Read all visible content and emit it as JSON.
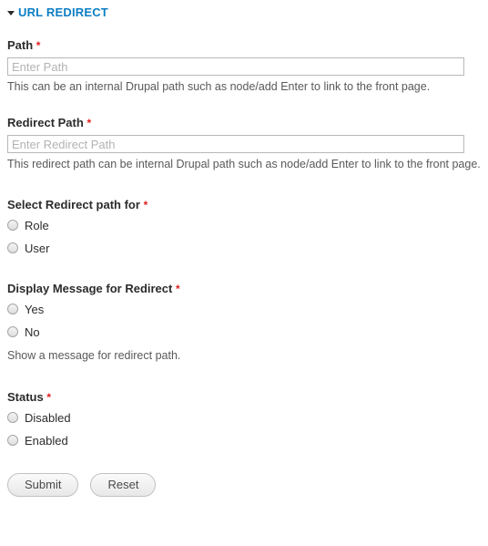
{
  "fieldset": {
    "title": "URL REDIRECT",
    "toggle_icon": "caret-down-icon",
    "accent_color": "#0c7ec4"
  },
  "required_marker": "*",
  "fields": {
    "path": {
      "label": "Path",
      "required": true,
      "placeholder": "Enter Path",
      "value": "",
      "description": "This can be an internal Drupal path such as node/add Enter to link to the front page."
    },
    "redirect_path": {
      "label": "Redirect Path",
      "required": true,
      "placeholder": "Enter Redirect Path",
      "value": "",
      "description": "This redirect path can be internal Drupal path such as node/add Enter to link to the front page."
    },
    "select_redirect_path_for": {
      "label": "Select Redirect path for",
      "required": true,
      "options": [
        {
          "label": "Role",
          "checked": false
        },
        {
          "label": "User",
          "checked": false
        }
      ]
    },
    "display_message_for_redirect": {
      "label": "Display Message for Redirect",
      "required": true,
      "options": [
        {
          "label": "Yes",
          "checked": false
        },
        {
          "label": "No",
          "checked": false
        }
      ],
      "description": "Show a message for redirect path."
    },
    "status": {
      "label": "Status",
      "required": true,
      "options": [
        {
          "label": "Disabled",
          "checked": false
        },
        {
          "label": "Enabled",
          "checked": false
        }
      ]
    }
  },
  "actions": {
    "submit_label": "Submit",
    "reset_label": "Reset"
  }
}
